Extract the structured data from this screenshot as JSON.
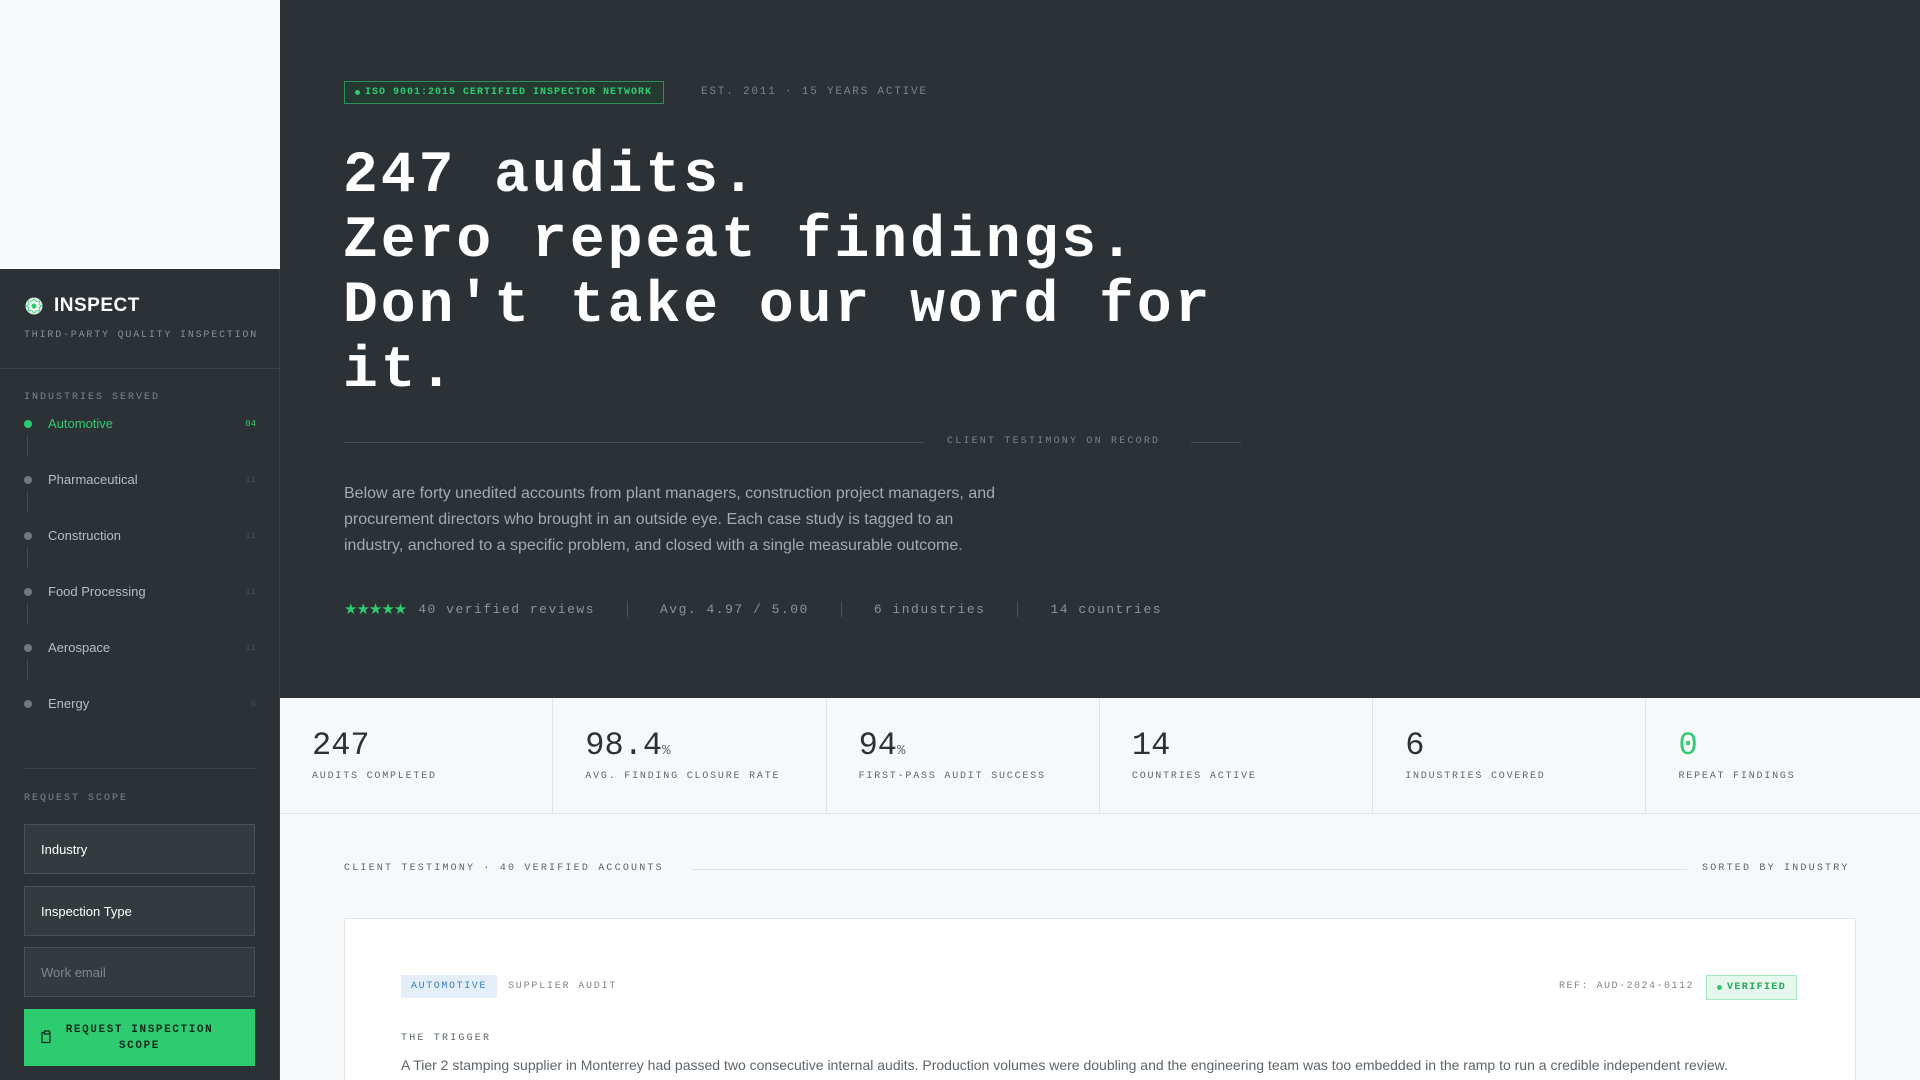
{
  "sidebar": {
    "brand": "INSPECT",
    "tagline": "THIRD-PARTY QUALITY INSPECTION",
    "industries_label": "INDUSTRIES SERVED",
    "industries": [
      {
        "label": "Automotive",
        "count": "04",
        "active": true
      },
      {
        "label": "Pharmaceutical",
        "count": "11",
        "active": false
      },
      {
        "label": "Construction",
        "count": "11",
        "active": false
      },
      {
        "label": "Food Processing",
        "count": "11",
        "active": false
      },
      {
        "label": "Aerospace",
        "count": "11",
        "active": false
      },
      {
        "label": "Energy",
        "count": "6",
        "active": false
      }
    ],
    "request_label": "REQUEST SCOPE",
    "fields": {
      "industry": "Industry",
      "inspection_type": "Inspection Type",
      "email_placeholder": "Work email"
    },
    "cta_label": "REQUEST INSPECTION SCOPE"
  },
  "hero": {
    "badge": "ISO 9001:2015 CERTIFIED INSPECTOR NETWORK",
    "est": "EST. 2011 · 15 YEARS ACTIVE",
    "headline_lines": [
      "247 audits.",
      "Zero repeat findings.",
      "Don't take our word for",
      "it."
    ],
    "divider_label": "CLIENT TESTIMONY ON RECORD",
    "intro": "Below are forty unedited accounts from plant managers, construction project managers, and procurement directors who brought in an outside eye. Each case study is tagged to an industry, anchored to a specific problem, and closed with a single measurable outcome.",
    "stars": "★★★★★",
    "rating": 5,
    "reviews": "40 verified reviews",
    "avg": "Avg. 4.97 / 5.00",
    "industries": "6 industries",
    "countries": "14 countries"
  },
  "stats": [
    {
      "value": "247",
      "unit": "",
      "label": "AUDITS COMPLETED"
    },
    {
      "value": "98.4",
      "unit": "%",
      "label": "AVG. FINDING CLOSURE RATE"
    },
    {
      "value": "94",
      "unit": "%",
      "label": "FIRST-PASS AUDIT SUCCESS"
    },
    {
      "value": "14",
      "unit": "",
      "label": "COUNTRIES ACTIVE"
    },
    {
      "value": "6",
      "unit": "",
      "label": "INDUSTRIES COVERED"
    },
    {
      "value": "0",
      "unit": "",
      "label": "REPEAT FINDINGS"
    }
  ],
  "testimony": {
    "heading": "CLIENT TESTIMONY · 40 VERIFIED ACCOUNTS",
    "sort": "SORTED BY INDUSTRY",
    "card": {
      "tag": "AUTOMOTIVE",
      "type": "SUPPLIER AUDIT",
      "ref": "REF: AUD-2024-0112",
      "status": "VERIFIED",
      "trigger_label": "THE TRIGGER",
      "trigger_text": "A Tier 2 stamping supplier in Monterrey had passed two consecutive internal audits. Production volumes were doubling and the engineering team was too embedded in the ramp to run a credible independent review."
    }
  },
  "colors": {
    "accent": "#2ecc71",
    "dark": "#2b3134",
    "tag_blue": "#3b7fc4"
  }
}
